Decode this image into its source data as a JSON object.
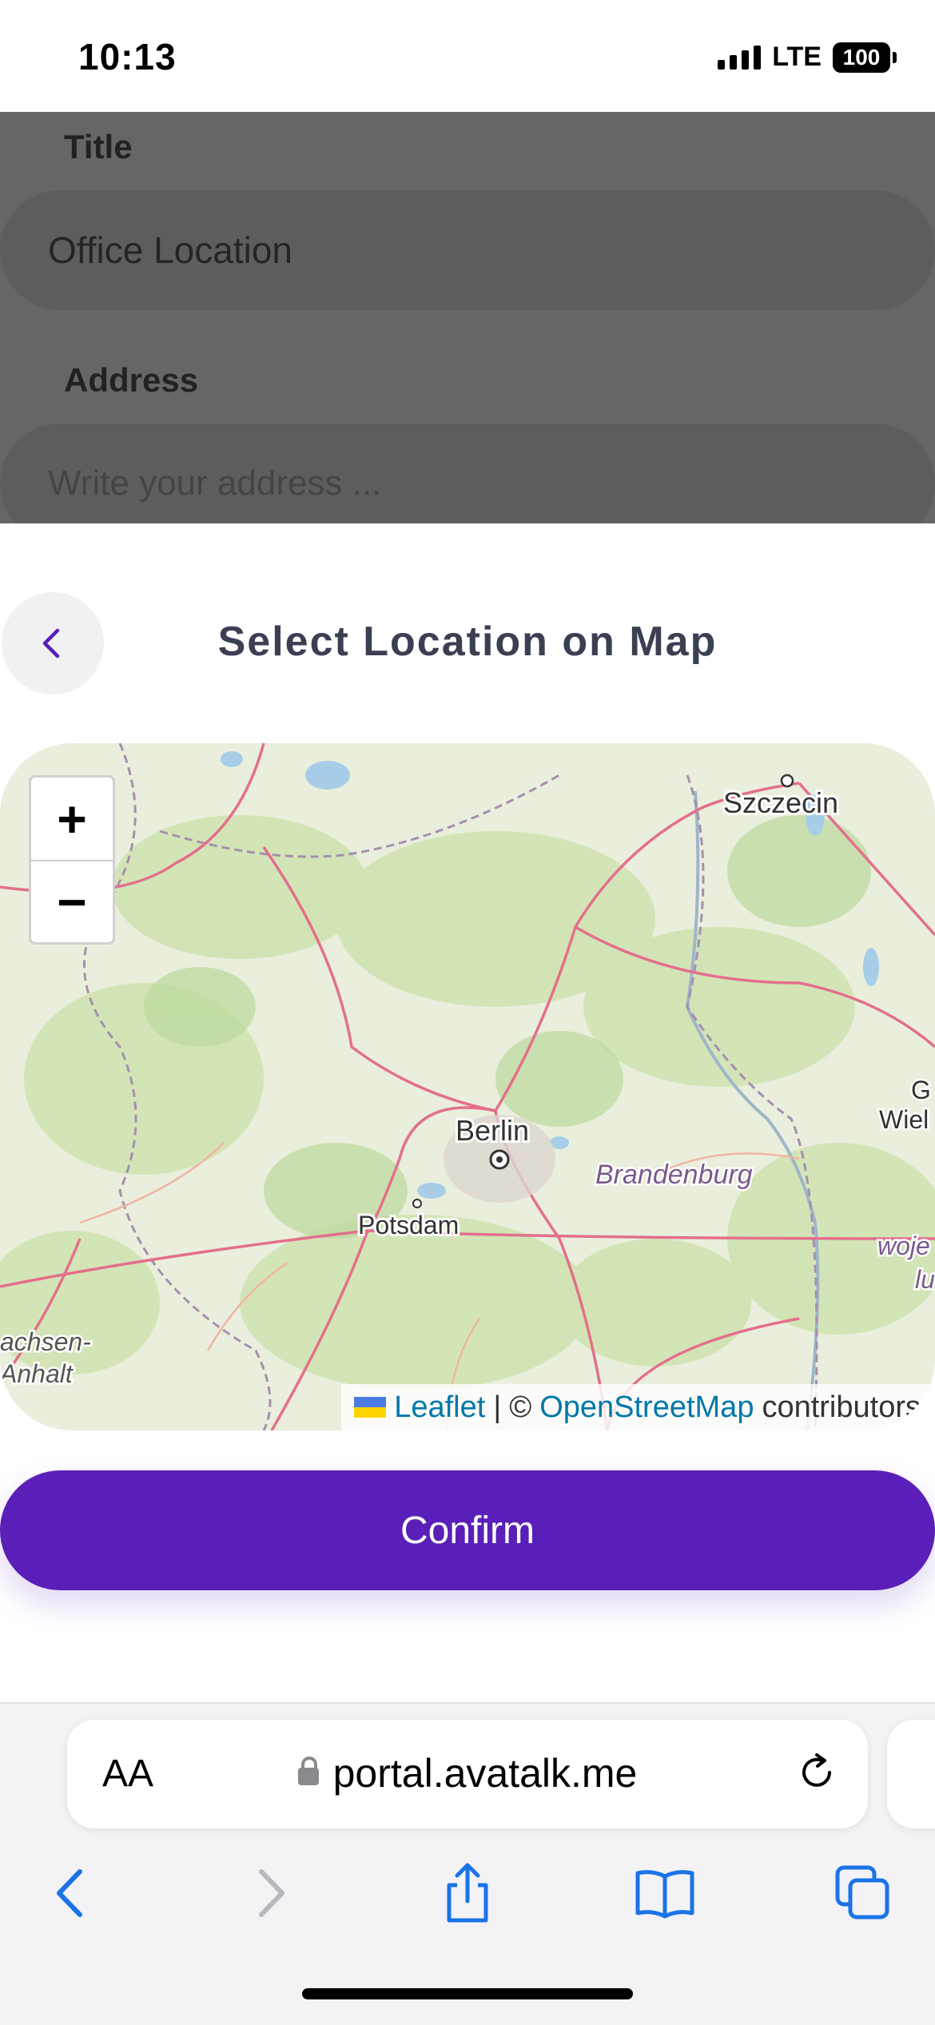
{
  "status_bar": {
    "time": "10:13",
    "network": "LTE",
    "battery": "100"
  },
  "form": {
    "title_label": "Title",
    "title_value": "Office Location",
    "address_label": "Address",
    "address_placeholder": "Write your address ..."
  },
  "sheet": {
    "title": "Select Location on Map",
    "back_icon": "chevron-left-icon",
    "confirm_label": "Confirm"
  },
  "map": {
    "zoom_in_label": "+",
    "zoom_out_label": "−",
    "places": {
      "szczecin": "Szczecin",
      "berlin": "Berlin",
      "brandenburg": "Brandenburg",
      "potsdam": "Potsdam",
      "sachsen_1": "achsen-",
      "sachsen_2": "Anhalt",
      "edge_1": "G",
      "edge_2": "Wiel",
      "edge_3": "woje",
      "edge_4": "lu"
    },
    "attribution": {
      "leaflet": "Leaflet",
      "separator": "|",
      "copyright": "©",
      "osm": "OpenStreetMap",
      "contributors": "contributors"
    }
  },
  "browser": {
    "text_size_label": "AA",
    "url": "portal.avatalk.me",
    "toolbar": [
      "back-icon",
      "forward-icon",
      "share-icon",
      "bookmarks-icon",
      "tabs-icon"
    ]
  },
  "colors": {
    "accent": "#5a1fb8",
    "link": "#0078a8",
    "backdrop": "#666666"
  }
}
